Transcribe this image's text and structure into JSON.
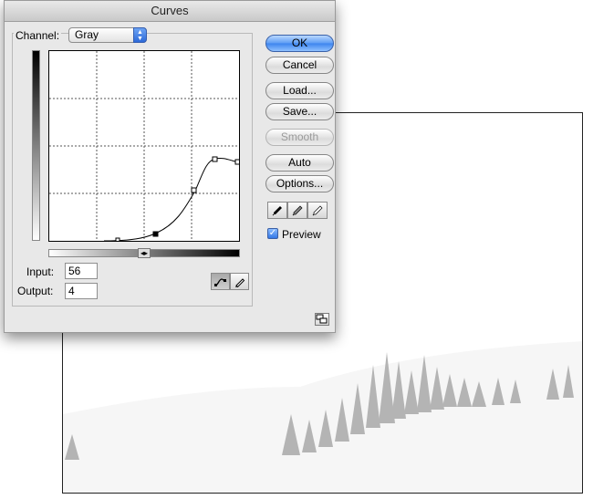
{
  "dialog": {
    "title": "Curves"
  },
  "channel": {
    "label": "Channel:",
    "value": "Gray"
  },
  "input": {
    "label": "Input:",
    "value": "56"
  },
  "output": {
    "label": "Output:",
    "value": "4"
  },
  "buttons": {
    "ok": "OK",
    "cancel": "Cancel",
    "load": "Load...",
    "save": "Save...",
    "smooth": "Smooth",
    "auto": "Auto",
    "options": "Options..."
  },
  "preview": {
    "label": "Preview",
    "checked": true
  },
  "icons": {
    "channel_select": "updown-arrows-icon",
    "curve_tool": "curve-tool-icon",
    "pencil_tool": "pencil-tool-icon",
    "black_eyedropper": "black-eyedropper-icon",
    "gray_eyedropper": "gray-eyedropper-icon",
    "white_eyedropper": "white-eyedropper-icon",
    "gradient_toggle": "gradient-direction-icon",
    "expand": "expand-dialog-icon"
  },
  "colors": {
    "default_button": "#3c84ee",
    "checkbox": "#3478e6",
    "dialog_bg": "#e8e8e8"
  }
}
